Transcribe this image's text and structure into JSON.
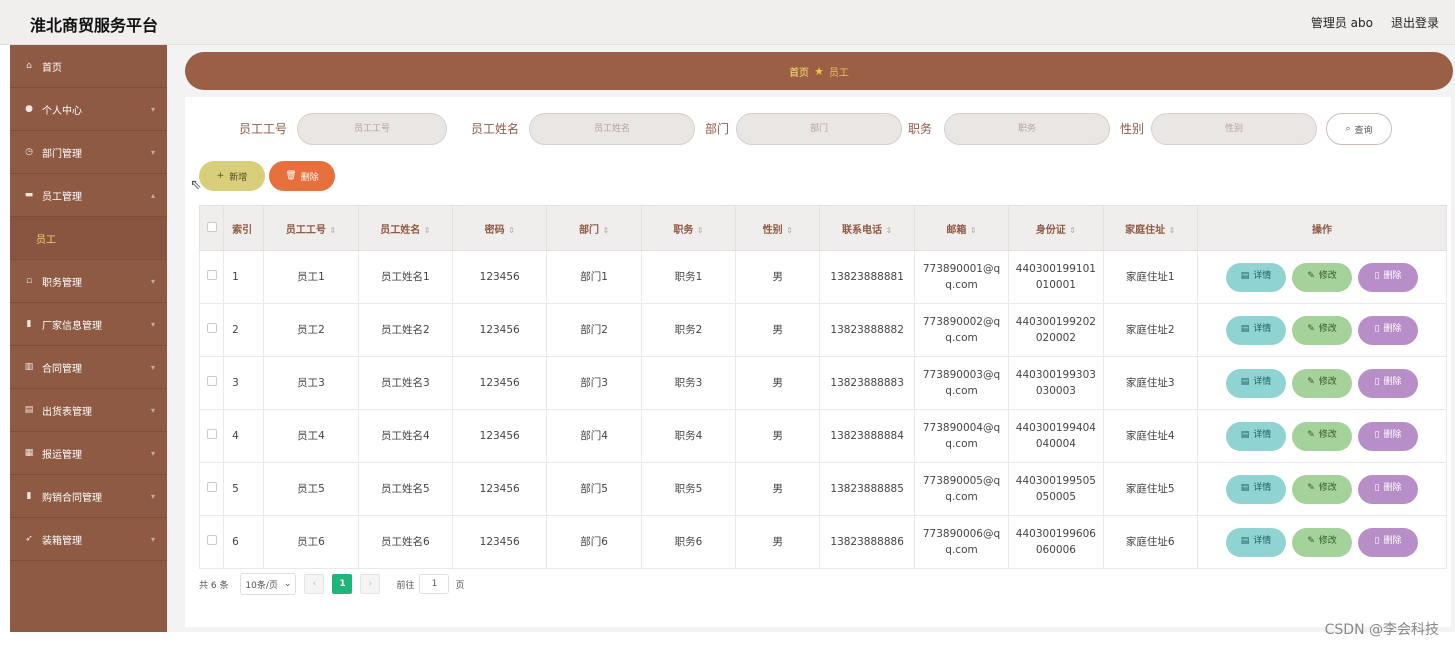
{
  "header": {
    "app_title": "淮北商贸服务平台",
    "user_label": "管理员 abo",
    "logout_label": "退出登录"
  },
  "sidebar": {
    "items": [
      {
        "label": "首页",
        "icon": "home-icon"
      },
      {
        "label": "个人中心",
        "icon": "user-icon"
      },
      {
        "label": "部门管理",
        "icon": "clock-icon"
      },
      {
        "label": "员工管理",
        "icon": "briefcase-icon"
      },
      {
        "label": "员工",
        "icon": ""
      },
      {
        "label": "职务管理",
        "icon": "document-icon"
      },
      {
        "label": "厂家信息管理",
        "icon": "trash-icon"
      },
      {
        "label": "合同管理",
        "icon": "bar-chart-icon"
      },
      {
        "label": "出货表管理",
        "icon": "column-chart-icon"
      },
      {
        "label": "报运管理",
        "icon": "grid-icon"
      },
      {
        "label": "购销合同管理",
        "icon": "trash-icon"
      },
      {
        "label": "装箱管理",
        "icon": "send-icon"
      }
    ]
  },
  "breadcrumb": {
    "home": "首页",
    "current": "员工"
  },
  "search": {
    "fields": [
      {
        "label": "员工工号",
        "placeholder": "员工工号"
      },
      {
        "label": "员工姓名",
        "placeholder": "员工姓名"
      },
      {
        "label": "部门",
        "placeholder": "部门"
      },
      {
        "label": "职务",
        "placeholder": "职务"
      },
      {
        "label": "性别",
        "placeholder": "性别"
      }
    ],
    "button_label": "查询"
  },
  "actions": {
    "add_label": "新增",
    "delete_label": "删除"
  },
  "table": {
    "headers": [
      "索引",
      "员工工号",
      "员工姓名",
      "密码",
      "部门",
      "职务",
      "性别",
      "联系电话",
      "邮箱",
      "身份证",
      "家庭住址",
      "操作"
    ],
    "rows": [
      [
        "1",
        "员工1",
        "员工姓名1",
        "123456",
        "部门1",
        "职务1",
        "男",
        "13823888881",
        "773890001@q",
        "q.com",
        "440300199101",
        "010001",
        "家庭住址1"
      ],
      [
        "2",
        "员工2",
        "员工姓名2",
        "123456",
        "部门2",
        "职务2",
        "男",
        "13823888882",
        "773890002@q",
        "q.com",
        "440300199202",
        "020002",
        "家庭住址2"
      ],
      [
        "3",
        "员工3",
        "员工姓名3",
        "123456",
        "部门3",
        "职务3",
        "男",
        "13823888883",
        "773890003@q",
        "q.com",
        "440300199303",
        "030003",
        "家庭住址3"
      ],
      [
        "4",
        "员工4",
        "员工姓名4",
        "123456",
        "部门4",
        "职务4",
        "男",
        "13823888884",
        "773890004@q",
        "q.com",
        "440300199404",
        "040004",
        "家庭住址4"
      ],
      [
        "5",
        "员工5",
        "员工姓名5",
        "123456",
        "部门5",
        "职务5",
        "男",
        "13823888885",
        "773890005@q",
        "q.com",
        "440300199505",
        "050005",
        "家庭住址5"
      ],
      [
        "6",
        "员工6",
        "员工姓名6",
        "123456",
        "部门6",
        "职务6",
        "男",
        "13823888886",
        "773890006@q",
        "q.com",
        "440300199606",
        "060006",
        "家庭住址6"
      ]
    ],
    "ops": {
      "detail": "详情",
      "edit": "修改",
      "delete": "删除"
    }
  },
  "pagination": {
    "total": "共 6 条",
    "page_size": "10条/页",
    "current_page": "1",
    "goto_label": "前往",
    "goto_value": "1",
    "page_suffix": "页"
  },
  "watermark": "CSDN @李会科技",
  "colors": {
    "sidebar": "#8f5a43",
    "breadcrumb": "#9a5f45",
    "accent_text": "#8d5a45",
    "add": "#d9ce7a",
    "delete": "#e76f3c",
    "detail": "#8fd3d3",
    "edit": "#a5d29a",
    "row_delete": "#b88ec9",
    "page_active": "#1fb67a"
  }
}
